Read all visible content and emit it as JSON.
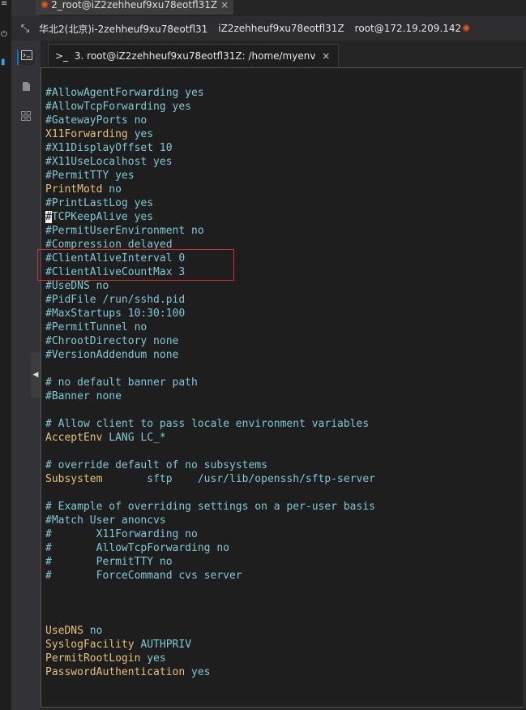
{
  "left_strip": {
    "icons": [
      "≡",
      "⏻",
      "▮"
    ]
  },
  "top_tab": {
    "label": "2_root@iZ2zehheuf9xu78eotfl31Z",
    "close": "×"
  },
  "infobar": {
    "expand": "⤡",
    "region": "华北2(北京)i-2zehheuf9xu78eotfl31",
    "host": "iZ2zehheuf9xu78eotfl31Z",
    "user_at": "root@172.19.209.142"
  },
  "sidebar": {
    "icons": [
      "terminal-icon",
      "file-icon",
      "grid-icon"
    ]
  },
  "term_tab": {
    "prompt": ">_",
    "label": "3. root@iZ2zehheuf9xu78eotfl31Z: /home/myenv",
    "close": "×"
  },
  "colors": {
    "comment": "#7fc8d6",
    "keyword": "#e5c07b",
    "highlight": "#d32f2f"
  },
  "lines": [
    [
      {
        "t": "#AllowAgentForwarding yes"
      }
    ],
    [
      {
        "t": "#AllowTcpForwarding yes"
      }
    ],
    [
      {
        "t": "#GatewayPorts no"
      }
    ],
    [
      {
        "t": "X11Forwarding",
        "c": "kw"
      },
      {
        "t": " yes",
        "c": "val"
      }
    ],
    [
      {
        "t": "#X11DisplayOffset 10"
      }
    ],
    [
      {
        "t": "#X11UseLocalhost yes"
      }
    ],
    [
      {
        "t": "#PermitTTY yes"
      }
    ],
    [
      {
        "t": "PrintMotd",
        "c": "kw"
      },
      {
        "t": " no",
        "c": "val"
      }
    ],
    [
      {
        "t": "#PrintLastLog yes"
      }
    ],
    [
      {
        "t": "#",
        "c": "cursor"
      },
      {
        "t": "TCPKeepAlive yes"
      }
    ],
    [
      {
        "t": "#PermitUserEnvironment no"
      }
    ],
    [
      {
        "t": "#Compression delayed"
      }
    ],
    [
      {
        "t": "#ClientAliveInterval 0"
      }
    ],
    [
      {
        "t": "#ClientAliveCountMax 3"
      }
    ],
    [
      {
        "t": "#UseDNS no"
      }
    ],
    [
      {
        "t": "#PidFile /run/sshd.pid"
      }
    ],
    [
      {
        "t": "#MaxStartups 10:30:100"
      }
    ],
    [
      {
        "t": "#PermitTunnel no"
      }
    ],
    [
      {
        "t": "#ChrootDirectory none"
      }
    ],
    [
      {
        "t": "#VersionAddendum none"
      }
    ],
    [],
    [
      {
        "t": "# no default banner path"
      }
    ],
    [
      {
        "t": "#Banner none"
      }
    ],
    [],
    [
      {
        "t": "# Allow client to pass locale environment variables"
      }
    ],
    [
      {
        "t": "AcceptEnv",
        "c": "kw"
      },
      {
        "t": " LANG LC_*",
        "c": "val"
      }
    ],
    [],
    [
      {
        "t": "# override default of no subsystems"
      }
    ],
    [
      {
        "t": "Subsystem",
        "c": "kw"
      },
      {
        "t": "       sftp    /usr/lib/openssh/sftp-server",
        "c": "val"
      }
    ],
    [],
    [
      {
        "t": "# Example of overriding settings on a per-user basis"
      }
    ],
    [
      {
        "t": "#Match User anoncvs"
      }
    ],
    [
      {
        "t": "#       X11Forwarding no"
      }
    ],
    [
      {
        "t": "#       AllowTcpForwarding no"
      }
    ],
    [
      {
        "t": "#       PermitTTY no"
      }
    ],
    [
      {
        "t": "#       ForceCommand cvs server"
      }
    ],
    [],
    [],
    [],
    [
      {
        "t": "UseDNS",
        "c": "kw"
      },
      {
        "t": " no",
        "c": "val"
      }
    ],
    [
      {
        "t": "SyslogFacility",
        "c": "kw"
      },
      {
        "t": " AUTHPRIV",
        "c": "val"
      }
    ],
    [
      {
        "t": "PermitRootLogin",
        "c": "kw"
      },
      {
        "t": " yes",
        "c": "val"
      }
    ],
    [
      {
        "t": "PasswordAuthentication",
        "c": "kw"
      },
      {
        "t": " yes",
        "c": "val"
      }
    ]
  ]
}
